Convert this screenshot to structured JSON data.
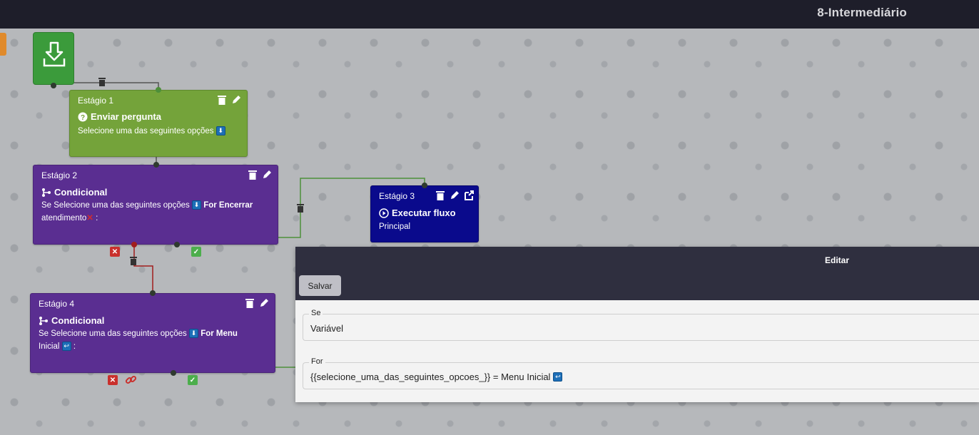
{
  "header": {
    "title": "8-Intermediário"
  },
  "nodes": {
    "stage1": {
      "stage": "Estágio 1",
      "title": "Enviar pergunta",
      "desc": "Selecione uma das seguintes opções"
    },
    "stage2": {
      "stage": "Estágio 2",
      "title": "Condicional",
      "desc_line1": "Se Selecione uma das seguintes opções",
      "desc_for": "For Encerrar",
      "desc_line2": "atendimento",
      "desc_end": ":"
    },
    "stage3": {
      "stage": "Estágio 3",
      "title": "Executar fluxo",
      "desc": "Principal"
    },
    "stage4": {
      "stage": "Estágio 4",
      "title": "Condicional",
      "desc_line1": "Se Selecione uma das seguintes opções",
      "desc_for": "For Menu",
      "desc_line2": "Inicial",
      "desc_end": ":"
    }
  },
  "panel": {
    "title": "Editar",
    "save_label": "Salvar",
    "se_legend": "Se",
    "se_value": "Variável",
    "for_legend": "For",
    "for_value": "{{selecione_uma_das_seguintes_opcoes_}} = Menu Inicial"
  },
  "colors": {
    "stage1": "#74a33a",
    "conditional": "#5a2e91",
    "execute_flow": "#0a0a8c",
    "panel_header": "#2f2f3f"
  },
  "icons": [
    "download-icon",
    "trash-icon",
    "pencil-icon",
    "question-circle-icon",
    "branch-icon",
    "play-circle-icon",
    "external-link-icon",
    "down-arrow-badge-icon",
    "return-badge-icon",
    "x-mark-icon",
    "link-icon",
    "check-icon"
  ]
}
